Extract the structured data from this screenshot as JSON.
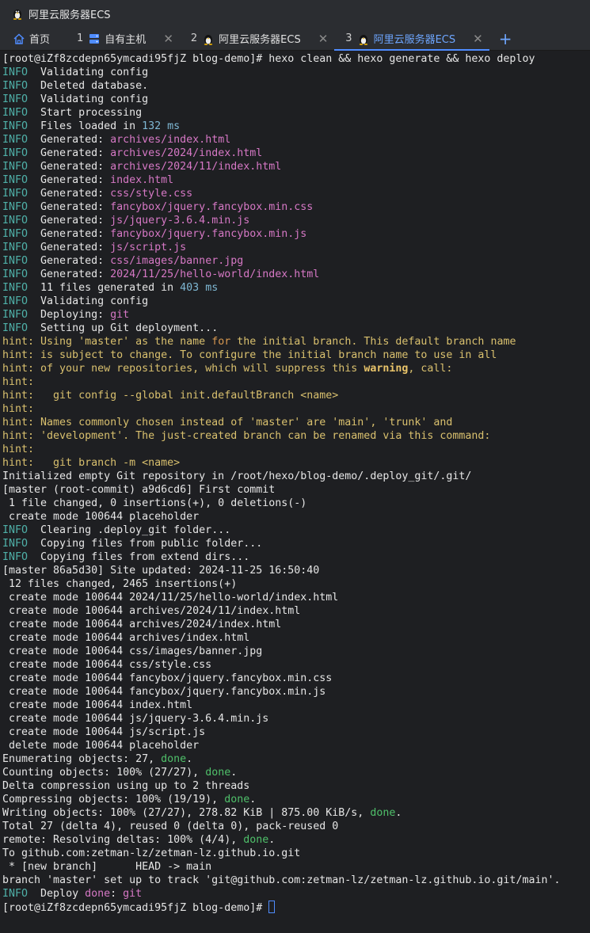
{
  "window": {
    "title": "阿里云服务器ECS"
  },
  "tabs": [
    {
      "label": "首页",
      "icon": "home-icon"
    },
    {
      "num": "1",
      "label": "自有主机",
      "icon": "server-icon"
    },
    {
      "num": "2",
      "label": "阿里云服务器ECS",
      "icon": "tux-icon"
    },
    {
      "num": "3",
      "label": "阿里云服务器ECS",
      "icon": "tux-icon",
      "active": true
    }
  ],
  "add_tab": "+",
  "close_glyph": "✕",
  "terminal": {
    "lines": [
      [
        [
          "",
          "[root@iZf8zcdepn65ymcadi95fjZ blog-demo]# hexo clean && hexo generate && hexo deploy"
        ]
      ],
      [
        [
          "lv",
          "INFO"
        ],
        [
          "",
          "  Validating config"
        ]
      ],
      [
        [
          "lv",
          "INFO"
        ],
        [
          "",
          "  Deleted database."
        ]
      ],
      [
        [
          "lv",
          "INFO"
        ],
        [
          "",
          "  Validating config"
        ]
      ],
      [
        [
          "lv",
          "INFO"
        ],
        [
          "",
          "  Start processing"
        ]
      ],
      [
        [
          "lv",
          "INFO"
        ],
        [
          "",
          "  Files loaded in "
        ],
        [
          "num-c",
          "132 ms"
        ]
      ],
      [
        [
          "lv",
          "INFO"
        ],
        [
          "",
          "  Generated: "
        ],
        [
          "path",
          "archives/index.html"
        ]
      ],
      [
        [
          "lv",
          "INFO"
        ],
        [
          "",
          "  Generated: "
        ],
        [
          "path",
          "archives/2024/index.html"
        ]
      ],
      [
        [
          "lv",
          "INFO"
        ],
        [
          "",
          "  Generated: "
        ],
        [
          "path",
          "archives/2024/11/index.html"
        ]
      ],
      [
        [
          "lv",
          "INFO"
        ],
        [
          "",
          "  Generated: "
        ],
        [
          "path",
          "index.html"
        ]
      ],
      [
        [
          "lv",
          "INFO"
        ],
        [
          "",
          "  Generated: "
        ],
        [
          "path",
          "css/style.css"
        ]
      ],
      [
        [
          "lv",
          "INFO"
        ],
        [
          "",
          "  Generated: "
        ],
        [
          "path",
          "fancybox/jquery.fancybox.min.css"
        ]
      ],
      [
        [
          "lv",
          "INFO"
        ],
        [
          "",
          "  Generated: "
        ],
        [
          "path",
          "js/jquery-3.6.4.min.js"
        ]
      ],
      [
        [
          "lv",
          "INFO"
        ],
        [
          "",
          "  Generated: "
        ],
        [
          "path",
          "fancybox/jquery.fancybox.min.js"
        ]
      ],
      [
        [
          "lv",
          "INFO"
        ],
        [
          "",
          "  Generated: "
        ],
        [
          "path",
          "js/script.js"
        ]
      ],
      [
        [
          "lv",
          "INFO"
        ],
        [
          "",
          "  Generated: "
        ],
        [
          "path",
          "css/images/banner.jpg"
        ]
      ],
      [
        [
          "lv",
          "INFO"
        ],
        [
          "",
          "  Generated: "
        ],
        [
          "path",
          "2024/11/25/hello-world/index.html"
        ]
      ],
      [
        [
          "lv",
          "INFO"
        ],
        [
          "",
          "  11 files generated in "
        ],
        [
          "num-c",
          "403 ms"
        ]
      ],
      [
        [
          "lv",
          "INFO"
        ],
        [
          "",
          "  Validating config"
        ]
      ],
      [
        [
          "lv",
          "INFO"
        ],
        [
          "",
          "  Deploying: "
        ],
        [
          "path",
          "git"
        ]
      ],
      [
        [
          "lv",
          "INFO"
        ],
        [
          "",
          "  Setting up Git deployment..."
        ]
      ],
      [
        [
          "hint",
          "hint: Using 'master' as the name "
        ],
        [
          "kw",
          "for"
        ],
        [
          "hint",
          " the initial branch. This default branch name"
        ]
      ],
      [
        [
          "hint",
          "hint: is subject to change. To configure the initial branch name to use in all"
        ]
      ],
      [
        [
          "hint",
          "hint: of your new repositories, which will suppress this "
        ],
        [
          "warnw",
          "warning"
        ],
        [
          "hint",
          ", call:"
        ]
      ],
      [
        [
          "hint",
          "hint:"
        ]
      ],
      [
        [
          "hint",
          "hint:   git config --global init.defaultBranch <name>"
        ]
      ],
      [
        [
          "hint",
          "hint:"
        ]
      ],
      [
        [
          "hint",
          "hint: Names commonly chosen instead of 'master' are 'main', 'trunk' and"
        ]
      ],
      [
        [
          "hint",
          "hint: 'development'. The just-created branch can be renamed via this command:"
        ]
      ],
      [
        [
          "hint",
          "hint:"
        ]
      ],
      [
        [
          "hint",
          "hint:   git branch -m <name>"
        ]
      ],
      [
        [
          "",
          "Initialized empty Git repository in /root/hexo/blog-demo/.deploy_git/.git/"
        ]
      ],
      [
        [
          "",
          "[master (root-commit) a9d6cd6] First commit"
        ]
      ],
      [
        [
          "",
          " 1 file changed, 0 insertions(+), 0 deletions(-)"
        ]
      ],
      [
        [
          "",
          " create mode 100644 placeholder"
        ]
      ],
      [
        [
          "lv",
          "INFO"
        ],
        [
          "",
          "  Clearing .deploy_git folder..."
        ]
      ],
      [
        [
          "lv",
          "INFO"
        ],
        [
          "",
          "  Copying files from public folder..."
        ]
      ],
      [
        [
          "lv",
          "INFO"
        ],
        [
          "",
          "  Copying files from extend dirs..."
        ]
      ],
      [
        [
          "",
          "[master 86a5d30] Site updated: 2024-11-25 16:50:40"
        ]
      ],
      [
        [
          "",
          " 12 files changed, 2465 insertions(+)"
        ]
      ],
      [
        [
          "",
          " create mode 100644 2024/11/25/hello-world/index.html"
        ]
      ],
      [
        [
          "",
          " create mode 100644 archives/2024/11/index.html"
        ]
      ],
      [
        [
          "",
          " create mode 100644 archives/2024/index.html"
        ]
      ],
      [
        [
          "",
          " create mode 100644 archives/index.html"
        ]
      ],
      [
        [
          "",
          " create mode 100644 css/images/banner.jpg"
        ]
      ],
      [
        [
          "",
          " create mode 100644 css/style.css"
        ]
      ],
      [
        [
          "",
          " create mode 100644 fancybox/jquery.fancybox.min.css"
        ]
      ],
      [
        [
          "",
          " create mode 100644 fancybox/jquery.fancybox.min.js"
        ]
      ],
      [
        [
          "",
          " create mode 100644 index.html"
        ]
      ],
      [
        [
          "",
          " create mode 100644 js/jquery-3.6.4.min.js"
        ]
      ],
      [
        [
          "",
          " create mode 100644 js/script.js"
        ]
      ],
      [
        [
          "",
          " delete mode 100644 placeholder"
        ]
      ],
      [
        [
          "",
          "Enumerating objects: 27, "
        ],
        [
          "ok",
          "done"
        ],
        [
          "",
          "."
        ]
      ],
      [
        [
          "",
          "Counting objects: 100% (27/27), "
        ],
        [
          "ok",
          "done"
        ],
        [
          "",
          "."
        ]
      ],
      [
        [
          "",
          "Delta compression using up to 2 threads"
        ]
      ],
      [
        [
          "",
          "Compressing objects: 100% (19/19), "
        ],
        [
          "ok",
          "done"
        ],
        [
          "",
          "."
        ]
      ],
      [
        [
          "",
          "Writing objects: 100% (27/27), 278.82 KiB | 875.00 KiB/s, "
        ],
        [
          "ok",
          "done"
        ],
        [
          "",
          "."
        ]
      ],
      [
        [
          "",
          "Total 27 (delta 4), reused 0 (delta 0), pack-reused 0"
        ]
      ],
      [
        [
          "",
          "remote: Resolving deltas: 100% (4/4), "
        ],
        [
          "ok",
          "done"
        ],
        [
          "",
          "."
        ]
      ],
      [
        [
          "",
          "To github.com:zetman-lz/zetman-lz.github.io.git"
        ]
      ],
      [
        [
          "",
          " * [new branch]      HEAD -> main"
        ]
      ],
      [
        [
          "",
          "branch 'master' set up to track 'git@github.com:zetman-lz/zetman-lz.github.io.git/main'."
        ]
      ],
      [
        [
          "lv",
          "INFO"
        ],
        [
          "",
          "  Deploy "
        ],
        [
          "path",
          "done"
        ],
        [
          "",
          ": "
        ],
        [
          "path",
          "git"
        ]
      ]
    ],
    "prompt": "[root@iZf8zcdepn65ymcadi95fjZ blog-demo]# "
  }
}
